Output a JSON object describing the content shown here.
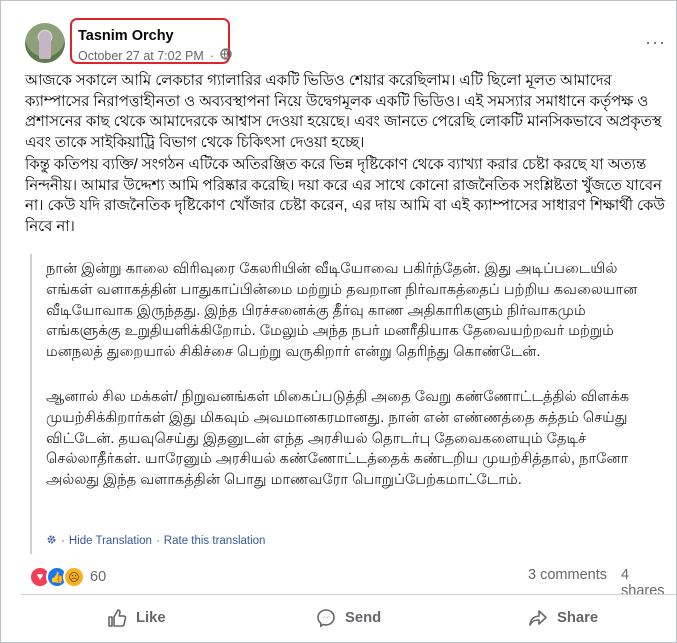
{
  "post": {
    "author": "Tasnim Orchy",
    "timestamp": "October 27 at 7:02 PM",
    "privacy_icon": "globe-icon",
    "more_options": "···",
    "body_bn": [
      "আজকে সকালে আমি লেকচার গ্যালারির একটি ভিডিও শেয়ার করেছিলাম। এটি ছিলো মূলত আমাদের ক্যাম্পাসের নিরাপত্তাহীনতা ও অব্যবস্থাপনা নিয়ে উদ্বেগমূলক একটি ভিডিও। এই সমস্যার সমাধানে কর্তৃপক্ষ ও প্রশাসনের কাছ থেকে আমাদেরকে আশ্বাস দেওয়া হয়েছে। এবং জানতে পেরেছি লোকটি মানসিকভাবে অপ্রকৃতস্থ এবং তাকে সাইকিয়াট্রি বিভাগ থেকে চিকিৎসা দেওয়া হচ্ছে।",
      "কিন্তু কতিপয় ব্যক্তি/ সংগঠন এটিকে অতিরঞ্জিত করে ভিন্ন দৃষ্টিকোণ থেকে ব্যাখ্যা করার চেষ্টা করছে যা অত্যন্ত নিন্দনীয়। আমার উদ্দেশ্য আমি পরিষ্কার করেছি। দয়া করে এর সাথে কোনো রাজনৈতিক সংশ্লিষ্টতা খুঁজতে যাবেন না। কেউ যদি রাজনৈতিক দৃষ্টিকোণ খোঁজার চেষ্টা করেন, এর দায় আমি বা এই ক্যাম্পাসের সাধারণ শিক্ষার্থী কেউ নিবে না।"
    ],
    "translation_ta": [
      "நான் இன்று காலை விரிவுரை கேலரியின் வீடியோவை பகிர்ந்தேன். இது அடிப்படையில் எங்கள் வளாகத்தின் பாதுகாப்பின்மை மற்றும் தவறான நிர்வாகத்தைப் பற்றிய கவலையான வீடியோவாக இருந்தது. இந்த பிரச்சனைக்கு தீர்வு காண அதிகாரிகளும் நிர்வாகமும் எங்களுக்கு உறுதியளிக்கிறோம். மேலும் அந்த நபர் மனரீதியாக தேவையற்றவர் மற்றும் மனநலத் துறையால் சிகிச்சை பெற்று வருகிறார் என்று தெரிந்து கொண்டேன்.",
      "ஆனால் சில மக்கள்/ நிறுவனங்கள் மிகைப்படுத்தி அதை வேறு கண்ணோட்டத்தில் விளக்க முயற்சிக்கிறார்கள் இது மிகவும் அவமானகரமானது. நான் என் எண்ணத்தை சுத்தம் செய்து விட்டேன். தயவுசெய்து இதனுடன் எந்த அரசியல் தொடர்பு தேவைகளையும் தேடிச் செல்லாதீர்கள். யாரேனும் அரசியல் கண்ணோட்டத்தைக் கண்டறிய முயற்சித்தால், நானோ அல்லது இந்த வளாகத்தின் பொது மாணவரோ பொறுப்பேற்கமாட்டோம்."
    ],
    "hide_translation": "Hide Translation",
    "rate_translation": "Rate this translation",
    "reaction_count": "60",
    "comments": "3 comments",
    "shares": "4 shares",
    "actions": {
      "like": "Like",
      "send": "Send",
      "share": "Share"
    }
  },
  "colors": {
    "highlight": "#e0242f",
    "link": "#385898",
    "muted": "#65676b"
  }
}
